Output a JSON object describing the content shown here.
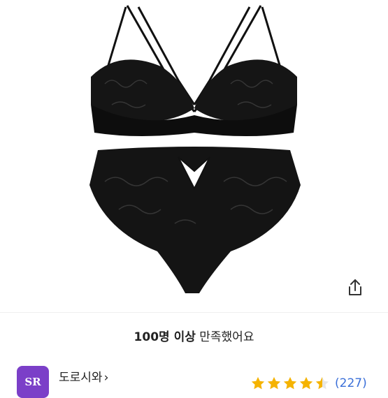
{
  "satisfaction": {
    "count": "100명 이상",
    "text": "만족했어요"
  },
  "shop": {
    "logo_text": "SR",
    "name": "도로시와",
    "chevron": "›"
  },
  "rating": {
    "stars": 4.5,
    "review_count": "(227)",
    "star_color": "#f5b301"
  },
  "icons": {
    "share": "share-icon"
  }
}
